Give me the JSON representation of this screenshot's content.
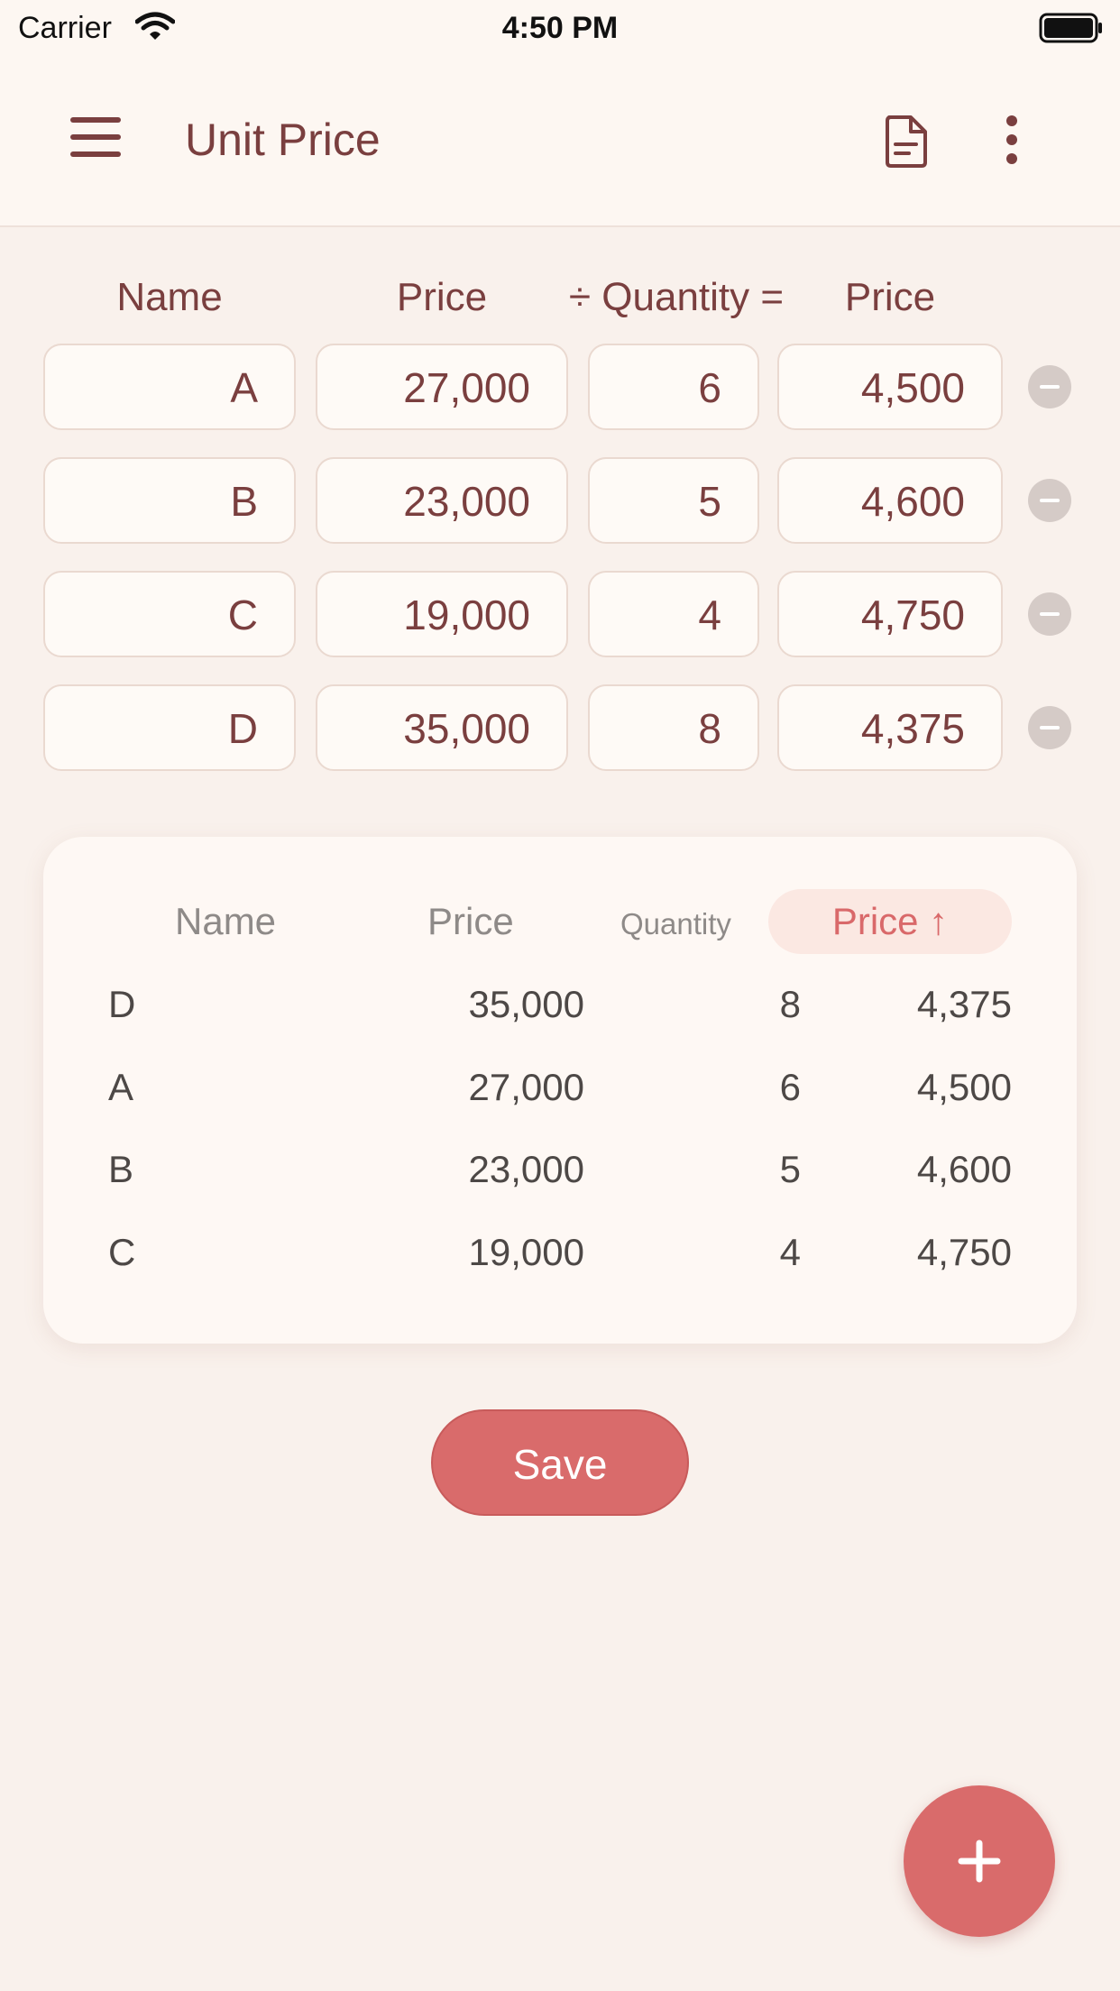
{
  "status_bar": {
    "carrier": "Carrier",
    "time": "4:50 PM"
  },
  "app_bar": {
    "title": "Unit Price",
    "icons": [
      "menu-icon",
      "document-icon",
      "more-vertical-icon"
    ]
  },
  "input_headers": {
    "name": "Name",
    "price": "Price",
    "quantity": "÷ Quantity =",
    "unit_price": "Price"
  },
  "input_rows": [
    {
      "name": "A",
      "price": "27,000",
      "quantity": "6",
      "unit_price": "4,500"
    },
    {
      "name": "B",
      "price": "23,000",
      "quantity": "5",
      "unit_price": "4,600"
    },
    {
      "name": "C",
      "price": "19,000",
      "quantity": "4",
      "unit_price": "4,750"
    },
    {
      "name": "D",
      "price": "35,000",
      "quantity": "8",
      "unit_price": "4,375"
    }
  ],
  "results": {
    "headers": {
      "name": "Name",
      "price": "Price",
      "quantity": "Quantity",
      "unit_price": "Price ↑"
    },
    "rows": [
      {
        "name": "D",
        "price": "35,000",
        "quantity": "8",
        "unit_price": "4,375"
      },
      {
        "name": "A",
        "price": "27,000",
        "quantity": "6",
        "unit_price": "4,500"
      },
      {
        "name": "B",
        "price": "23,000",
        "quantity": "5",
        "unit_price": "4,600"
      },
      {
        "name": "C",
        "price": "19,000",
        "quantity": "4",
        "unit_price": "4,750"
      }
    ]
  },
  "save_label": "Save",
  "colors": {
    "accent": "#d96b6b",
    "text": "#7a3f3f",
    "background": "#f9f1ec"
  }
}
